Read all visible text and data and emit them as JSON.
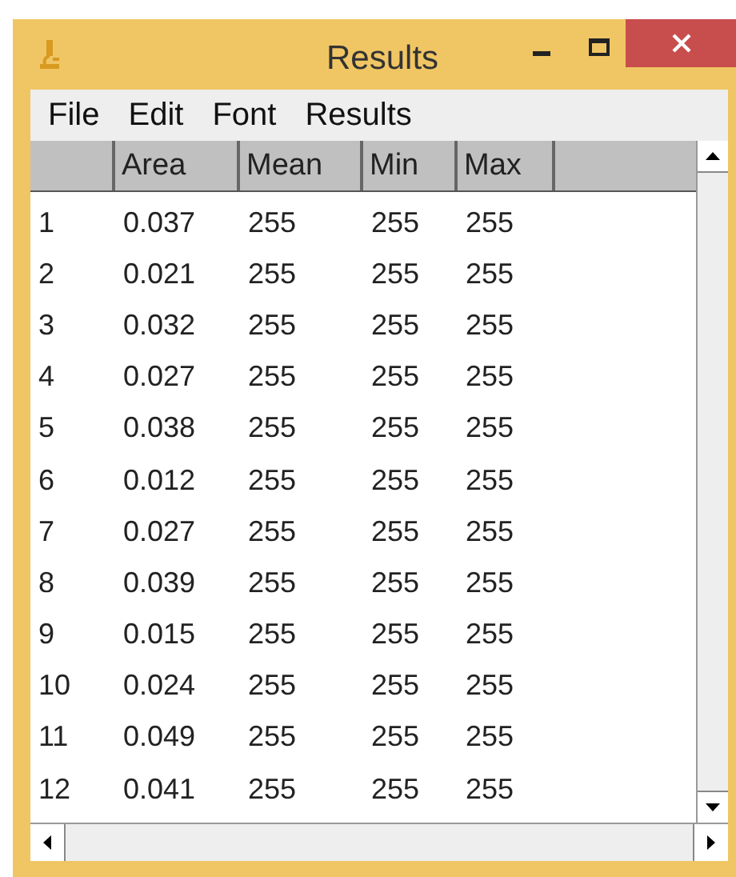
{
  "window": {
    "title": "Results"
  },
  "menu": [
    "File",
    "Edit",
    "Font",
    "Results"
  ],
  "table": {
    "columns": [
      "",
      "Area",
      "Mean",
      "Min",
      "Max"
    ],
    "rows": [
      [
        "1",
        "0.037",
        "255",
        "255",
        "255"
      ],
      [
        "2",
        "0.021",
        "255",
        "255",
        "255"
      ],
      [
        "3",
        "0.032",
        "255",
        "255",
        "255"
      ],
      [
        "4",
        "0.027",
        "255",
        "255",
        "255"
      ],
      [
        "5",
        "0.038",
        "255",
        "255",
        "255"
      ],
      [
        "6",
        "0.012",
        "255",
        "255",
        "255"
      ],
      [
        "7",
        "0.027",
        "255",
        "255",
        "255"
      ],
      [
        "8",
        "0.039",
        "255",
        "255",
        "255"
      ],
      [
        "9",
        "0.015",
        "255",
        "255",
        "255"
      ],
      [
        "10",
        "0.024",
        "255",
        "255",
        "255"
      ],
      [
        "11",
        "0.049",
        "255",
        "255",
        "255"
      ],
      [
        "12",
        "0.041",
        "255",
        "255",
        "255"
      ]
    ]
  }
}
